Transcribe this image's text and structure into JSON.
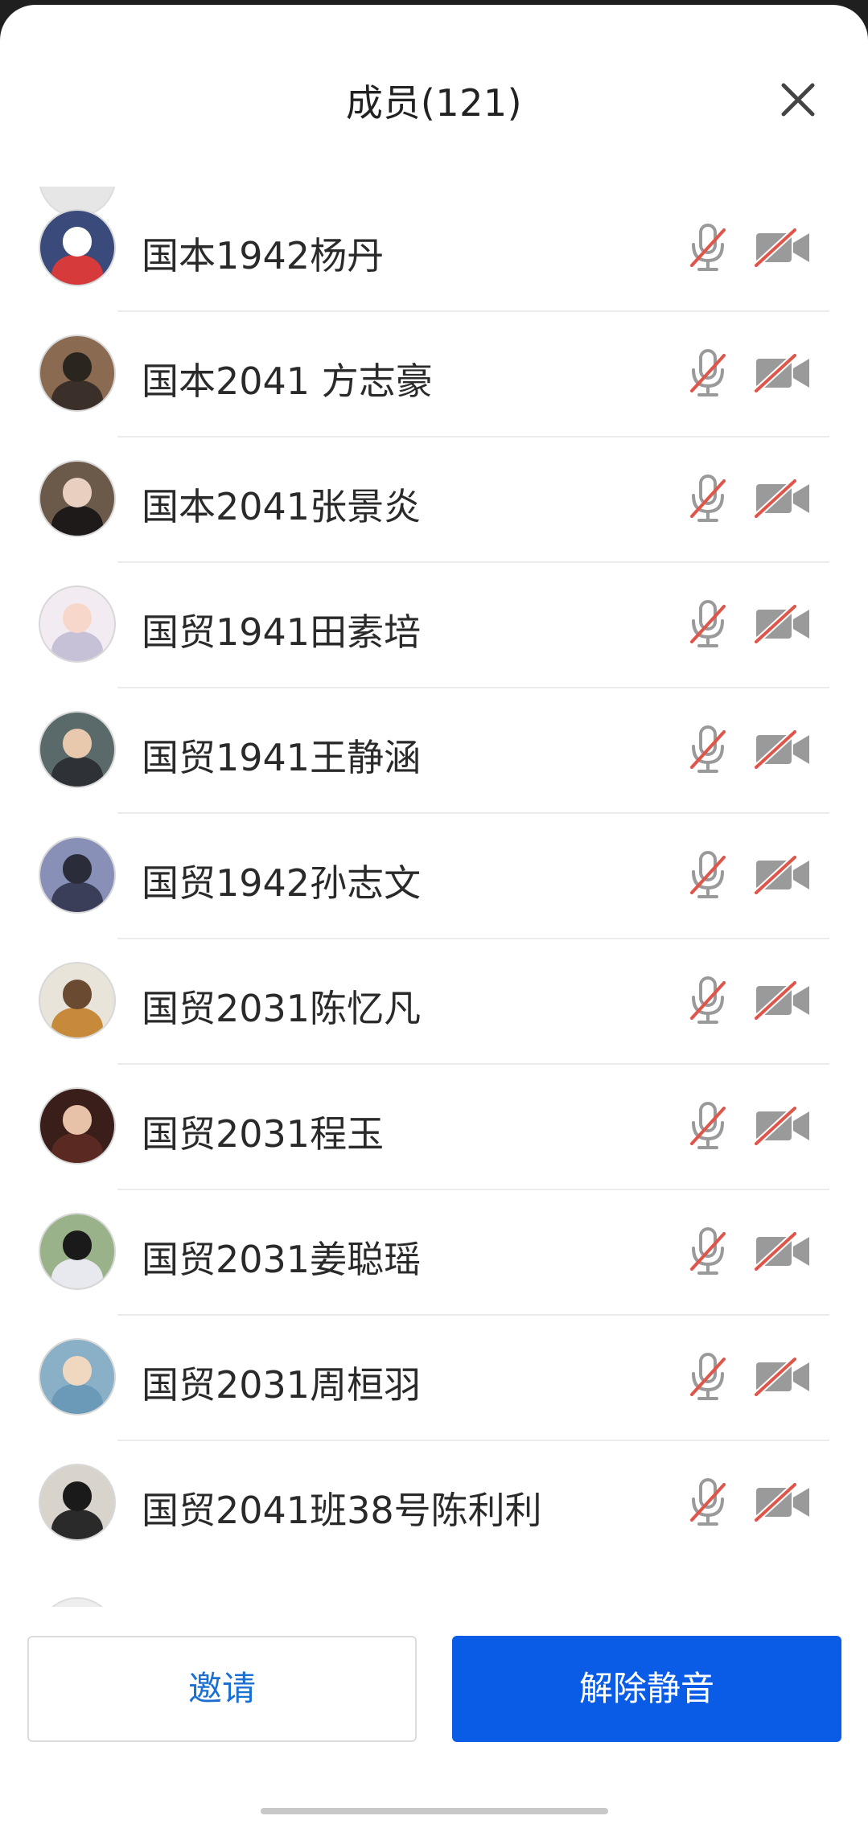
{
  "header": {
    "title": "成员(121)"
  },
  "members": [
    {
      "name": "国本1942杨丹",
      "avatar_color": "#3a4a7a",
      "avatar_accent": "#ffffff",
      "avatar_body": "#d63a3a",
      "mic": "muted",
      "camera": "off"
    },
    {
      "name": "国本2041 方志豪",
      "avatar_color": "#8a6a50",
      "avatar_accent": "#2b2520",
      "avatar_body": "#3a3029",
      "mic": "muted",
      "camera": "off"
    },
    {
      "name": "国本2041张景炎",
      "avatar_color": "#6b5a4a",
      "avatar_accent": "#e8cfc0",
      "avatar_body": "#1e1a1a",
      "mic": "muted",
      "camera": "off"
    },
    {
      "name": "国贸1941田素培",
      "avatar_color": "#f2ecf2",
      "avatar_accent": "#f7d7c9",
      "avatar_body": "#c7c1d8",
      "mic": "muted",
      "camera": "off"
    },
    {
      "name": "国贸1941王静涵",
      "avatar_color": "#5a6a6a",
      "avatar_accent": "#e9c9ad",
      "avatar_body": "#2e3136",
      "mic": "muted",
      "camera": "off"
    },
    {
      "name": "国贸1942孙志文",
      "avatar_color": "#8890b8",
      "avatar_accent": "#2a2c3a",
      "avatar_body": "#3a3e58",
      "mic": "muted",
      "camera": "off"
    },
    {
      "name": "国贸2031陈忆凡",
      "avatar_color": "#e9e4da",
      "avatar_accent": "#6a4a30",
      "avatar_body": "#c78a3a",
      "mic": "muted",
      "camera": "off"
    },
    {
      "name": "国贸2031程玉",
      "avatar_color": "#3a1e1a",
      "avatar_accent": "#e8c2a8",
      "avatar_body": "#5a2a22",
      "mic": "muted",
      "camera": "off"
    },
    {
      "name": "国贸2031姜聪瑶",
      "avatar_color": "#9ab28a",
      "avatar_accent": "#1a1a1a",
      "avatar_body": "#e8e8ef",
      "mic": "muted",
      "camera": "off"
    },
    {
      "name": "国贸2031周桓羽",
      "avatar_color": "#8ab0c8",
      "avatar_accent": "#f0d8c0",
      "avatar_body": "#6a9ab8",
      "mic": "muted",
      "camera": "off"
    },
    {
      "name": "国贸2041班38号陈利利",
      "avatar_color": "#d8d4cc",
      "avatar_accent": "#1a1a1a",
      "avatar_body": "#2a2a2a",
      "mic": "muted",
      "camera": "off"
    }
  ],
  "footer": {
    "invite_label": "邀请",
    "unmute_label": "解除静音"
  },
  "colors": {
    "primary": "#0a5ce6",
    "link": "#1a6fd1",
    "muted_slash": "#e0554a",
    "icon_gray": "#9a9a9a"
  }
}
